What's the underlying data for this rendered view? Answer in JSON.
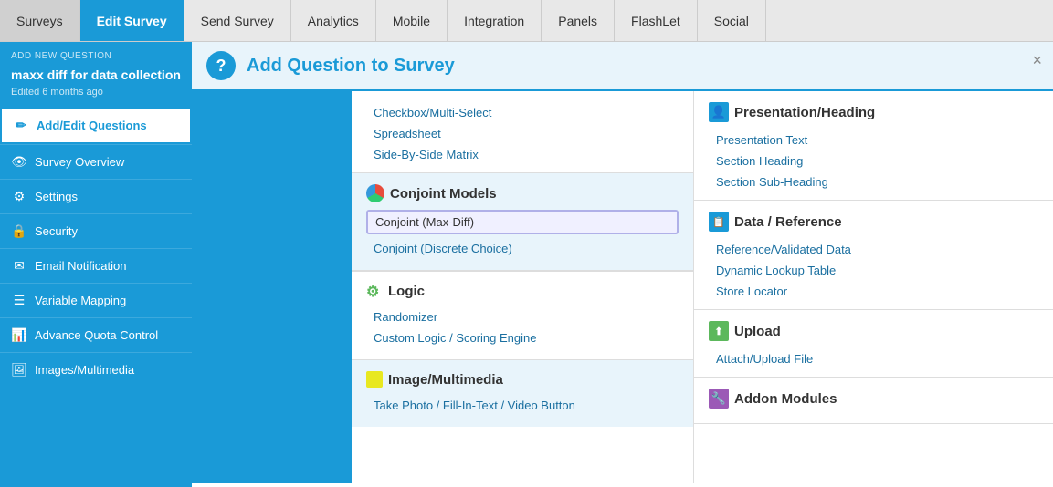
{
  "nav": {
    "tabs": [
      {
        "label": "Surveys",
        "active": false
      },
      {
        "label": "Edit Survey",
        "active": true
      },
      {
        "label": "Send Survey",
        "active": false
      },
      {
        "label": "Analytics",
        "active": false
      },
      {
        "label": "Mobile",
        "active": false
      },
      {
        "label": "Integration",
        "active": false
      },
      {
        "label": "Panels",
        "active": false
      },
      {
        "label": "FlashLet",
        "active": false
      },
      {
        "label": "Social",
        "active": false
      }
    ]
  },
  "sidebar": {
    "add_new_label": "ADD NEW QUESTION",
    "survey_title": "maxx diff for data collection",
    "edited_label": "Edited 6 months ago",
    "items": [
      {
        "label": "Add/Edit Questions",
        "active": true,
        "icon": "edit"
      },
      {
        "label": "Survey Overview",
        "active": false,
        "icon": "eye"
      },
      {
        "label": "Settings",
        "active": false,
        "icon": "gear"
      },
      {
        "label": "Security",
        "active": false,
        "icon": "lock"
      },
      {
        "label": "Email Notification",
        "active": false,
        "icon": "mail"
      },
      {
        "label": "Variable Mapping",
        "active": false,
        "icon": "list"
      },
      {
        "label": "Advance Quota Control",
        "active": false,
        "icon": "chart"
      },
      {
        "label": "Images/Multimedia",
        "active": false,
        "icon": "image"
      }
    ]
  },
  "modal": {
    "title": "Add Question to Survey",
    "close_label": "×",
    "question_types": [
      {
        "label": "Checkbox/Multi-Select"
      },
      {
        "label": "Spreadsheet"
      },
      {
        "label": "Side-By-Side Matrix"
      }
    ],
    "conjoint_section": {
      "title": "Conjoint Models",
      "items": [
        {
          "label": "Conjoint (Max-Diff)",
          "selected": true
        },
        {
          "label": "Conjoint (Discrete Choice)"
        }
      ]
    },
    "logic_section": {
      "title": "Logic",
      "items": [
        {
          "label": "Randomizer"
        },
        {
          "label": "Custom Logic / Scoring Engine"
        }
      ]
    },
    "image_section": {
      "title": "Image/Multimedia",
      "items": [
        {
          "label": "Take Photo / Fill-In-Text / Video Button"
        }
      ]
    },
    "right_sections": {
      "presentation": {
        "title": "Presentation/Heading",
        "items": [
          {
            "label": "Presentation Text"
          },
          {
            "label": "Section Heading"
          },
          {
            "label": "Section Sub-Heading"
          }
        ]
      },
      "data_reference": {
        "title": "Data / Reference",
        "items": [
          {
            "label": "Reference/Validated Data"
          },
          {
            "label": "Dynamic Lookup Table"
          },
          {
            "label": "Store Locator"
          }
        ]
      },
      "upload": {
        "title": "Upload",
        "items": [
          {
            "label": "Attach/Upload File"
          }
        ]
      },
      "addon": {
        "title": "Addon Modules",
        "items": []
      }
    }
  }
}
